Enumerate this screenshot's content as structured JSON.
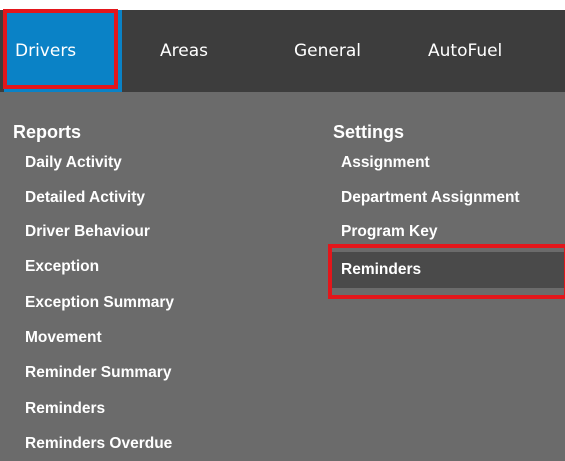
{
  "nav": {
    "tabs": [
      {
        "label": "Drivers",
        "active": true
      },
      {
        "label": "Areas"
      },
      {
        "label": "General"
      },
      {
        "label": "AutoFuel"
      }
    ]
  },
  "menu": {
    "reports": {
      "heading": "Reports",
      "items": [
        "Daily Activity",
        "Detailed Activity",
        "Driver Behaviour",
        "Exception",
        "Exception Summary",
        "Movement",
        "Reminder Summary",
        "Reminders",
        "Reminders Overdue"
      ]
    },
    "settings": {
      "heading": "Settings",
      "items": [
        "Assignment",
        "Department Assignment",
        "Program Key",
        "Reminders"
      ]
    }
  },
  "colors": {
    "topbar": "#3d3d3d",
    "active_tab": "#0a82c6",
    "menu_bg": "#6b6b6b",
    "highlight": "#e3161b"
  }
}
